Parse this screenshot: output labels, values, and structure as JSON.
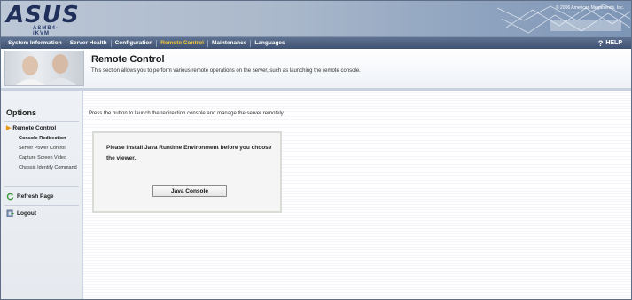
{
  "header": {
    "logo": "ASUS",
    "logo_sub": "ASMB4-iKVM",
    "copyright": "© 2006 American Megatrends, Inc."
  },
  "nav": {
    "items": [
      {
        "label": "System Information"
      },
      {
        "label": "Server Health"
      },
      {
        "label": "Configuration"
      },
      {
        "label": "Remote Control",
        "active": true
      },
      {
        "label": "Maintenance"
      },
      {
        "label": "Languages"
      }
    ],
    "help_label": "HELP",
    "help_icon": "question-mark-icon"
  },
  "banner": {
    "title": "Remote Control",
    "description": "This section allows you to perform various remote operations on the server, such as launching the remote console."
  },
  "sidebar": {
    "options_title": "Options",
    "section_label": "Remote Control",
    "items": [
      {
        "label": "Console Redirection"
      },
      {
        "label": "Server Power Control"
      },
      {
        "label": "Capture Screen Video"
      },
      {
        "label": "Chassis Identify Command"
      }
    ],
    "refresh_label": "Refresh Page",
    "logout_label": "Logout"
  },
  "main": {
    "instruction": "Press the button to launch the redirection console and manage the server remotely.",
    "message": "Please install Java Runtime Environment before you choose the viewer.",
    "java_button_label": "Java Console"
  },
  "colors": {
    "nav_bg": "#4b5e80",
    "nav_active": "#f0c43a",
    "arrow": "#e79a18",
    "sidebar_bg": "#eef1f5"
  }
}
